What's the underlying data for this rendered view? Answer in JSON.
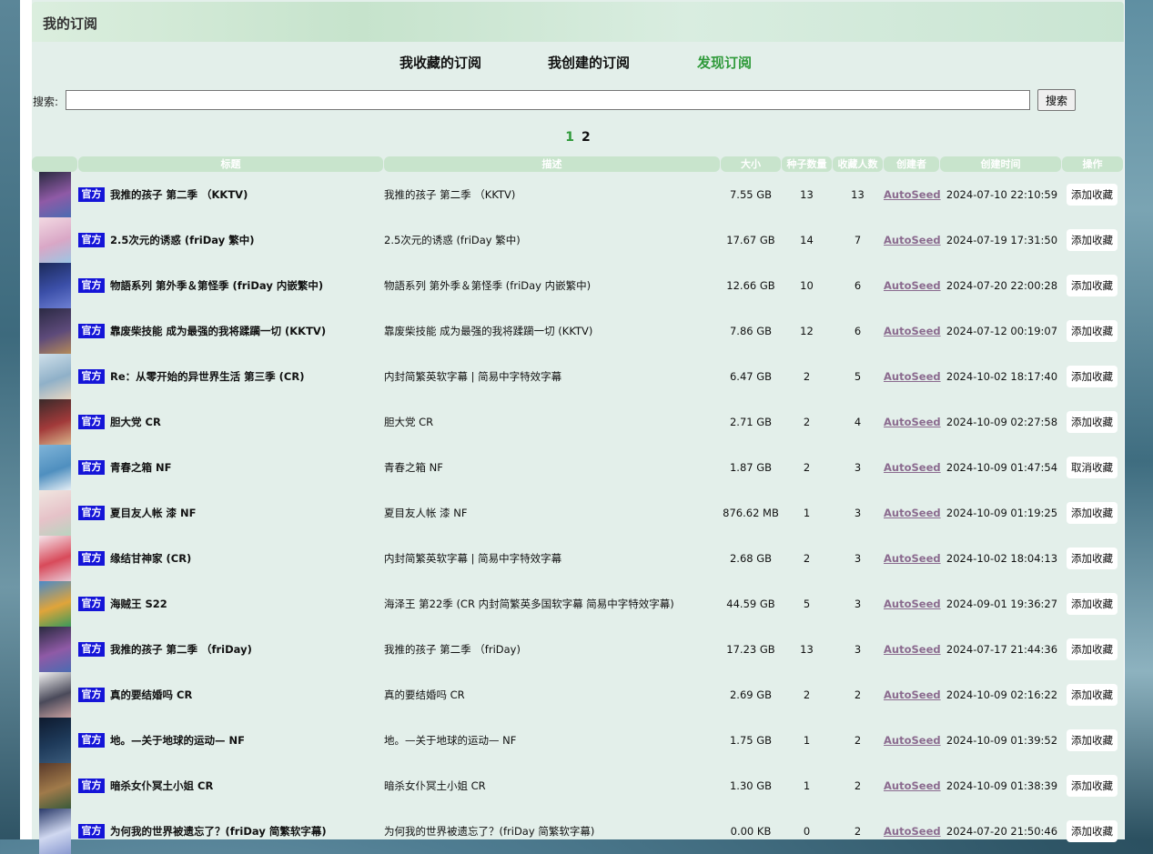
{
  "page": {
    "title": "我的订阅"
  },
  "tabs": [
    "我收藏的订阅",
    "我创建的订阅",
    "发现订阅"
  ],
  "search": {
    "label": "搜索:",
    "value": "",
    "button": "搜索"
  },
  "pagination": {
    "pages": [
      "1",
      "2"
    ],
    "current": "1"
  },
  "table": {
    "headers": [
      "标题",
      "描述",
      "大小",
      "种子数量",
      "收藏人数",
      "创建者",
      "创建时间",
      "操作"
    ],
    "rows": [
      {
        "badge": "官方",
        "title": "我推的孩子 第二季 （KKTV)",
        "desc": "我推的孩子 第二季 （KKTV)",
        "size": "7.55 GB",
        "seeds": "13",
        "favs": "13",
        "creator": "AutoSeed",
        "time": "2024-07-10 22:10:59",
        "action": "添加收藏",
        "poster": [
          "#2a2a40",
          "#8f5aa6",
          "#4b6bb2"
        ]
      },
      {
        "badge": "官方",
        "title": "2.5次元的诱惑 (friDay 繁中)",
        "desc": "2.5次元的诱惑 (friDay 繁中)",
        "size": "17.67 GB",
        "seeds": "14",
        "favs": "7",
        "creator": "AutoSeed",
        "time": "2024-07-19 17:31:50",
        "action": "添加收藏",
        "poster": [
          "#f2d9e2",
          "#d9a7c6",
          "#9cc5e3"
        ]
      },
      {
        "badge": "官方",
        "title": "物語系列 第外季＆第怪季 (friDay 内嵌繁中)",
        "desc": "物語系列 第外季＆第怪季 (friDay 内嵌繁中)",
        "size": "12.66 GB",
        "seeds": "10",
        "favs": "6",
        "creator": "AutoSeed",
        "time": "2024-07-20 22:00:28",
        "action": "添加收藏",
        "poster": [
          "#1b2a5a",
          "#3b4fa8",
          "#6d7fd3"
        ]
      },
      {
        "badge": "官方",
        "title": "靠废柴技能 成为最强的我将蹂躏一切 (KKTV)",
        "desc": "靠废柴技能 成为最强的我将蹂躏一切 (KKTV)",
        "size": "7.86 GB",
        "seeds": "12",
        "favs": "6",
        "creator": "AutoSeed",
        "time": "2024-07-12 00:19:07",
        "action": "添加收藏",
        "poster": [
          "#2b2a44",
          "#5d4a7a",
          "#b48a5a"
        ]
      },
      {
        "badge": "官方",
        "title": "Re：从零开始的异世界生活 第三季 (CR)",
        "desc": "内封简繁英软字幕 | 简易中字特效字幕",
        "size": "6.47 GB",
        "seeds": "2",
        "favs": "5",
        "creator": "AutoSeed",
        "time": "2024-10-02 18:17:40",
        "action": "添加收藏",
        "poster": [
          "#cfe0ea",
          "#8fb0c8",
          "#e8d7c3"
        ]
      },
      {
        "badge": "官方",
        "title": "胆大党 CR",
        "desc": "胆大党 CR",
        "size": "2.71 GB",
        "seeds": "2",
        "favs": "4",
        "creator": "AutoSeed",
        "time": "2024-10-09 02:27:58",
        "action": "添加收藏",
        "poster": [
          "#3a2a2a",
          "#a23a3a",
          "#d9b48a"
        ]
      },
      {
        "badge": "官方",
        "title": "青春之箱 NF",
        "desc": "青春之箱 NF",
        "size": "1.87 GB",
        "seeds": "2",
        "favs": "3",
        "creator": "AutoSeed",
        "time": "2024-10-09 01:47:54",
        "action": "取消收藏",
        "poster": [
          "#7fb4d8",
          "#4f8fbf",
          "#e5eef5"
        ]
      },
      {
        "badge": "官方",
        "title": "夏目友人帐 漆 NF",
        "desc": "夏目友人帐 漆 NF",
        "size": "876.62 MB",
        "seeds": "1",
        "favs": "3",
        "creator": "AutoSeed",
        "time": "2024-10-09 01:19:25",
        "action": "添加收藏",
        "poster": [
          "#f0e6e0",
          "#e6c2c8",
          "#b8d4c0"
        ]
      },
      {
        "badge": "官方",
        "title": "缘结甘神家 (CR)",
        "desc": "内封简繁英软字幕 | 简易中字特效字幕",
        "size": "2.68 GB",
        "seeds": "2",
        "favs": "3",
        "creator": "AutoSeed",
        "time": "2024-10-02 18:04:13",
        "action": "添加收藏",
        "poster": [
          "#f4e4ea",
          "#d84a5a",
          "#e8c9d6"
        ]
      },
      {
        "badge": "官方",
        "title": "海贼王 S22",
        "desc": "海泽王 第22季 (CR 内封简繁英多国软字幕 简易中字特效字幕)",
        "size": "44.59 GB",
        "seeds": "5",
        "favs": "3",
        "creator": "AutoSeed",
        "time": "2024-09-01 19:36:27",
        "action": "添加收藏",
        "poster": [
          "#4a8ac8",
          "#e0a43a",
          "#3a9a5a"
        ]
      },
      {
        "badge": "官方",
        "title": "我推的孩子 第二季 （friDay)",
        "desc": "我推的孩子 第二季 （friDay)",
        "size": "17.23 GB",
        "seeds": "13",
        "favs": "3",
        "creator": "AutoSeed",
        "time": "2024-07-17 21:44:36",
        "action": "添加收藏",
        "poster": [
          "#2a2a40",
          "#8f5aa6",
          "#4b6bb2"
        ]
      },
      {
        "badge": "官方",
        "title": "真的要结婚吗 CR",
        "desc": "真的要结婚吗 CR",
        "size": "2.69 GB",
        "seeds": "2",
        "favs": "2",
        "creator": "AutoSeed",
        "time": "2024-10-09 02:16:22",
        "action": "添加收藏",
        "poster": [
          "#f2f2f2",
          "#4a4a5a",
          "#c8a0a0"
        ]
      },
      {
        "badge": "官方",
        "title": "地。—关于地球的运动— NF",
        "desc": "地。—关于地球的运动— NF",
        "size": "1.75 GB",
        "seeds": "1",
        "favs": "2",
        "creator": "AutoSeed",
        "time": "2024-10-09 01:39:52",
        "action": "添加收藏",
        "poster": [
          "#0e1a2e",
          "#1e3a5a",
          "#3a5a7a"
        ]
      },
      {
        "badge": "官方",
        "title": "暗杀女仆冥土小姐 CR",
        "desc": "暗杀女仆冥土小姐 CR",
        "size": "1.30 GB",
        "seeds": "1",
        "favs": "2",
        "creator": "AutoSeed",
        "time": "2024-10-09 01:38:39",
        "action": "添加收藏",
        "poster": [
          "#5a3a2a",
          "#a07a4a",
          "#3a5a3a"
        ]
      },
      {
        "badge": "官方",
        "title": "为何我的世界被遗忘了？(friDay 简繁软字幕)",
        "desc": "为何我的世界被遗忘了？(friDay 简繁软字幕)",
        "size": "0.00 KB",
        "seeds": "0",
        "favs": "2",
        "creator": "AutoSeed",
        "time": "2024-07-20 21:50:46",
        "action": "添加收藏",
        "poster": [
          "#2a3a6a",
          "#d0d8f0",
          "#8a9ad0"
        ]
      }
    ]
  },
  "colors": {
    "accent_green": "#2f9a3a",
    "badge_blue": "#1515d8",
    "header_green": "#c8e4cc",
    "panel_bg": "#e3efea",
    "creator_link": "#8b6b8f"
  }
}
